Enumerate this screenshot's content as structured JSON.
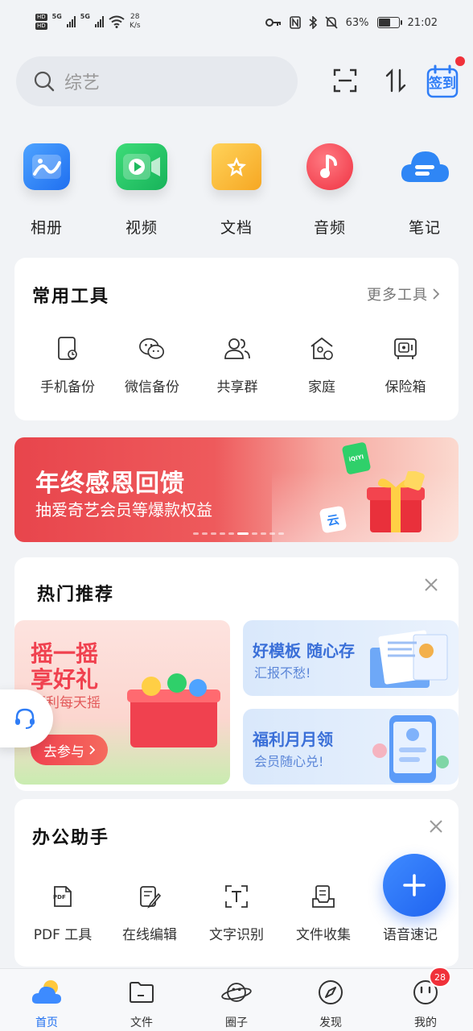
{
  "status_bar": {
    "left": {
      "hd1": "HD",
      "hd2": "HD",
      "net1": "5G",
      "net2": "5G",
      "speed_value": "28",
      "speed_unit": "K/s"
    },
    "right": {
      "battery_pct": "63%",
      "battery_level": 0.63,
      "time": "21:02"
    }
  },
  "search": {
    "placeholder": "综艺"
  },
  "header_actions": {
    "sign_in_label": "签到"
  },
  "categories": [
    {
      "label": "相册",
      "icon": "photo-album-icon",
      "color": "#2f86f5"
    },
    {
      "label": "视频",
      "icon": "video-icon",
      "color": "#22c55e"
    },
    {
      "label": "文档",
      "icon": "document-folder-icon",
      "color": "#f7b733"
    },
    {
      "label": "音频",
      "icon": "music-note-icon",
      "color": "#f0414f"
    },
    {
      "label": "笔记",
      "icon": "note-cloud-icon",
      "color": "#2f86f5"
    }
  ],
  "common_tools": {
    "title": "常用工具",
    "more_label": "更多工具",
    "items": [
      {
        "label": "手机备份",
        "icon": "phone-backup-icon"
      },
      {
        "label": "微信备份",
        "icon": "wechat-backup-icon"
      },
      {
        "label": "共享群",
        "icon": "shared-group-icon"
      },
      {
        "label": "家庭",
        "icon": "family-home-icon"
      },
      {
        "label": "保险箱",
        "icon": "safe-box-icon"
      }
    ]
  },
  "banner": {
    "title": "年终感恩回馈",
    "subtitle": "抽爱奇艺会员等爆款权益",
    "badge_iqiyi": "iQIYI",
    "badge_yun": "云"
  },
  "hot_recommend": {
    "title": "热门推荐",
    "left_tile": {
      "line1": "摇一摇",
      "line2": "享好礼",
      "line3": "福利每天摇",
      "cta": "去参与"
    },
    "right_tiles": [
      {
        "title": "好模板 随心存",
        "subtitle": "汇报不愁!"
      },
      {
        "title": "福利月月领",
        "subtitle": "会员随心兑!"
      }
    ]
  },
  "office_assistant": {
    "title": "办公助手",
    "items": [
      {
        "label": "PDF 工具",
        "icon": "pdf-tool-icon",
        "icon_text": "PDF"
      },
      {
        "label": "在线编辑",
        "icon": "online-edit-icon"
      },
      {
        "label": "文字识别",
        "icon": "text-recognition-icon"
      },
      {
        "label": "文件收集",
        "icon": "file-collect-icon"
      },
      {
        "label": "语音速记",
        "icon": "voice-note-icon"
      }
    ]
  },
  "bottom_nav": {
    "items": [
      {
        "label": "首页",
        "icon": "home-weather-icon",
        "active": true
      },
      {
        "label": "文件",
        "icon": "folder-icon",
        "active": false
      },
      {
        "label": "圈子",
        "icon": "planet-icon",
        "active": false
      },
      {
        "label": "发现",
        "icon": "compass-icon",
        "active": false
      },
      {
        "label": "我的",
        "icon": "profile-face-icon",
        "active": false
      }
    ],
    "profile_badge": "28"
  },
  "colors": {
    "accent": "#1f6ff0",
    "badge_red": "#f0313a",
    "background": "#f1f3f6"
  }
}
